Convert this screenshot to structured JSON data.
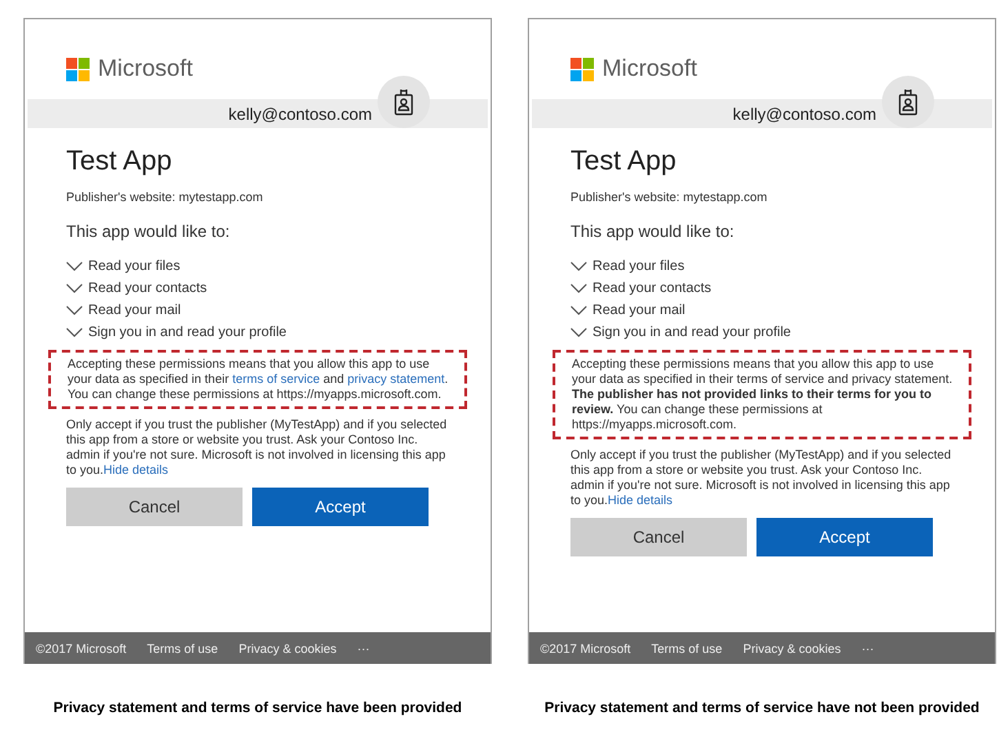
{
  "panels": [
    {
      "brand": "Microsoft",
      "account": "kelly@contoso.com",
      "app_title": "Test App",
      "publisher": "Publisher's website: mytestapp.com",
      "intro": "This app would like to:",
      "permissions": [
        "Read your files",
        "Read your contacts",
        "Read your mail",
        "Sign you in and read your profile"
      ],
      "notice": [
        {
          "kind": "text",
          "text": "Accepting these permissions means that you allow this app to use your data as specified in their "
        },
        {
          "kind": "link",
          "text": "terms of service"
        },
        {
          "kind": "text",
          "text": " and "
        },
        {
          "kind": "link",
          "text": "privacy statement"
        },
        {
          "kind": "text",
          "text": ". You can change these permissions at https://myapps.microsoft.com."
        }
      ],
      "trust_text": "Only accept if you trust the publisher (MyTestApp) and if you selected this app from a store or website you trust. Ask your Contoso Inc. admin if you're not sure. Microsoft is not involved in licensing this app to you.",
      "hide_link": "Hide details",
      "buttons": [
        {
          "kind": "secondary",
          "label": "Cancel"
        },
        {
          "kind": "primary",
          "label": "Accept"
        }
      ],
      "footer": [
        "©2017 Microsoft",
        "Terms of use",
        "Privacy & cookies",
        "···"
      ],
      "caption": "Privacy statement and terms of service have been provided"
    },
    {
      "brand": "Microsoft",
      "account": "kelly@contoso.com",
      "app_title": "Test App",
      "publisher": "Publisher's website: mytestapp.com",
      "intro": "This app would like to:",
      "permissions": [
        "Read your files",
        "Read your contacts",
        "Read your mail",
        "Sign you in and read your profile"
      ],
      "notice": [
        {
          "kind": "text",
          "text": "Accepting these permissions means that you allow this app to use your data as specified in their terms of service and privacy statement. **The publisher has not provided links to their terms for you to review.** You can change these permissions at https://myapps.microsoft.com."
        }
      ],
      "trust_text": "Only accept if you trust the publisher (MyTestApp) and if you selected this app from a store or website you trust. Ask your Contoso Inc. admin if you're not sure. Microsoft is not involved in licensing this app to you.",
      "hide_link": "Hide details",
      "buttons": [
        {
          "kind": "secondary",
          "label": "Cancel"
        },
        {
          "kind": "primary",
          "label": "Accept"
        }
      ],
      "footer": [
        "©2017 Microsoft",
        "Terms of use",
        "Privacy & cookies",
        "···"
      ],
      "caption": "Privacy statement and terms of service have not been provided"
    }
  ]
}
